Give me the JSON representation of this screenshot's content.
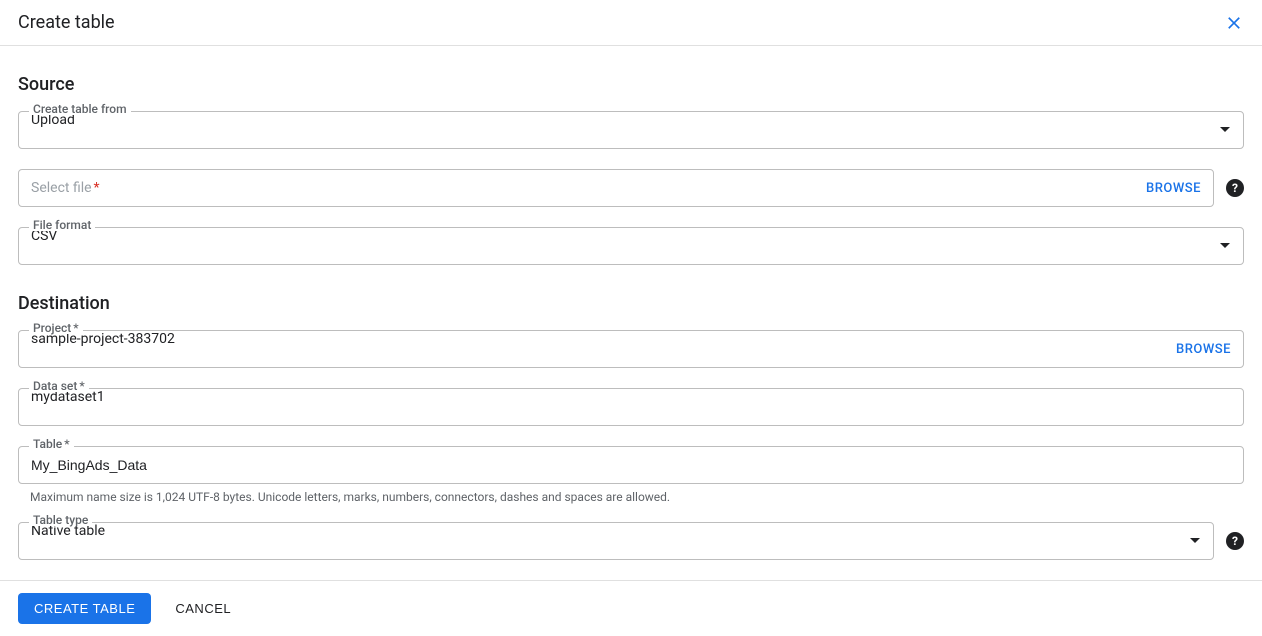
{
  "dialog_title": "Create table",
  "source": {
    "heading": "Source",
    "create_from_label": "Create table from",
    "create_from_value": "Upload",
    "select_file_placeholder": "Select file",
    "browse_label": "BROWSE",
    "file_format_label": "File format",
    "file_format_value": "CSV"
  },
  "destination": {
    "heading": "Destination",
    "project_label": "Project",
    "project_value": "sample-project-383702",
    "browse_label": "BROWSE",
    "dataset_label": "Data set",
    "dataset_value": "mydataset1",
    "table_label": "Table",
    "table_value": "My_BingAds_Data",
    "table_hint": "Maximum name size is 1,024 UTF-8 bytes. Unicode letters, marks, numbers, connectors, dashes and spaces are allowed.",
    "table_type_label": "Table type",
    "table_type_value": "Native table"
  },
  "footer": {
    "create_label": "CREATE TABLE",
    "cancel_label": "CANCEL"
  },
  "required_marker": "*",
  "help_marker": "?"
}
